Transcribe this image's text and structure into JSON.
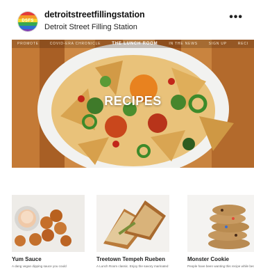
{
  "header": {
    "username": "detroitstreetfillingstation",
    "display_name": "Detroit Street Filling Station",
    "more_label": "•••",
    "avatar_text": "DSFS"
  },
  "hero": {
    "nav_items": [
      "PROMOTE",
      "COVID-ERA CHRONICLE",
      "THE LUNCH ROOM",
      "IN THE NEWS",
      "SIGN UP",
      "RECI"
    ],
    "title": "RECIPES"
  },
  "cards": [
    {
      "title": "Yum Sauce",
      "desc": "A dang vegan dipping sauce you could"
    },
    {
      "title": "Treetown Tempeh Rueben",
      "desc": "A Lunch Room classic. Enjoy the savory marinated tempeh and tangy flavors of the"
    },
    {
      "title": "Monster Cookie",
      "desc": "People have been wanting this recipe while because the monster cookie i"
    }
  ]
}
